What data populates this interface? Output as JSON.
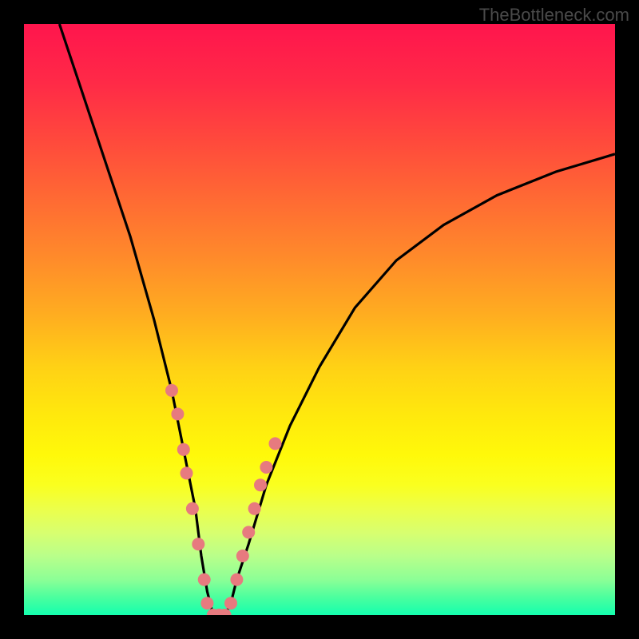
{
  "watermark": "TheBottleneck.com",
  "chart_data": {
    "type": "line",
    "title": "",
    "xlabel": "",
    "ylabel": "",
    "xlim": [
      0,
      100
    ],
    "ylim": [
      0,
      100
    ],
    "series": [
      {
        "name": "bottleneck-curve",
        "x": [
          6,
          10,
          14,
          18,
          22,
          25,
          27,
          29,
          30,
          31,
          32,
          33,
          34,
          35,
          36,
          38,
          41,
          45,
          50,
          56,
          63,
          71,
          80,
          90,
          100
        ],
        "y": [
          100,
          88,
          76,
          64,
          50,
          38,
          28,
          18,
          10,
          4,
          0,
          0,
          0,
          2,
          6,
          12,
          22,
          32,
          42,
          52,
          60,
          66,
          71,
          75,
          78
        ]
      }
    ],
    "markers": {
      "name": "highlight-points",
      "x": [
        25,
        26,
        27,
        27.5,
        28.5,
        29.5,
        30.5,
        31,
        32,
        33,
        34,
        35,
        36,
        37,
        38,
        39,
        40,
        41,
        42.5
      ],
      "y": [
        38,
        34,
        28,
        24,
        18,
        12,
        6,
        2,
        0,
        0,
        0,
        2,
        6,
        10,
        14,
        18,
        22,
        25,
        29
      ]
    },
    "colors": {
      "curve": "#000000",
      "marker": "#e77a7f",
      "background_top": "#ff154d",
      "background_bottom": "#14ffae"
    }
  }
}
